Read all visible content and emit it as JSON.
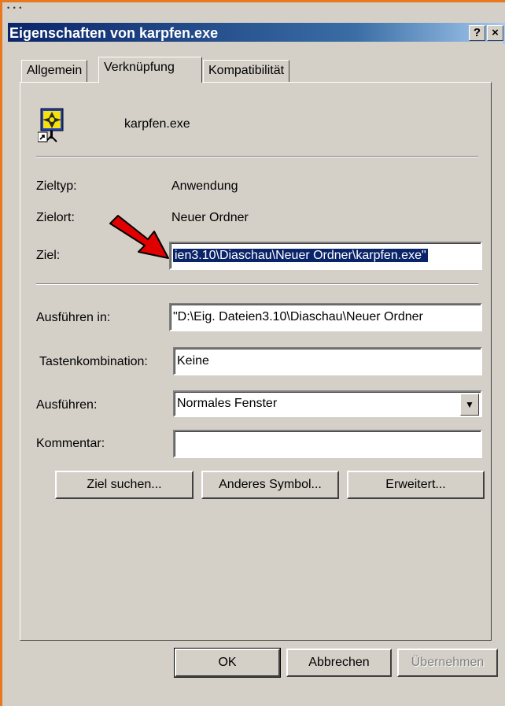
{
  "window": {
    "title": "Eigenschaften von karpfen.exe",
    "help_button": "?",
    "close_button": "×"
  },
  "tabs": [
    {
      "label": "Allgemein",
      "active": false
    },
    {
      "label": "Verknüpfung",
      "active": true
    },
    {
      "label": "Kompatibilität",
      "active": false
    }
  ],
  "shortcut": {
    "icon": "shortcut-app-icon",
    "name": "karpfen.exe",
    "zieltyp_label": "Zieltyp:",
    "zieltyp_value": "Anwendung",
    "zielort_label": "Zielort:",
    "zielort_value": "Neuer Ordner",
    "ziel_label": "Ziel:",
    "ziel_value": "ien3.10\\Diaschau\\Neuer Ordner\\karpfen.exe\"",
    "ausfuehren_in_label": "Ausführen in:",
    "ausfuehren_in_value": "\"D:\\Eig. Dateien3.10\\Diaschau\\Neuer Ordner",
    "tastenkombination_label": "Tastenkombination:",
    "tastenkombination_value": "Keine",
    "ausfuehren_label": "Ausführen:",
    "ausfuehren_value": "Normales Fenster",
    "kommentar_label": "Kommentar:",
    "kommentar_value": ""
  },
  "buttons": {
    "ziel_suchen": "Ziel suchen...",
    "anderes_symbol": "Anderes Symbol...",
    "erweitert": "Erweitert...",
    "ok": "OK",
    "abbrechen": "Abbrechen",
    "uebernehmen": "Übernehmen"
  },
  "colors": {
    "frame_accent": "#e8781e",
    "titlebar_start": "#0a246a",
    "titlebar_end": "#a6caf0",
    "selection": "#0a246a",
    "annotation_arrow": "#e00000"
  }
}
